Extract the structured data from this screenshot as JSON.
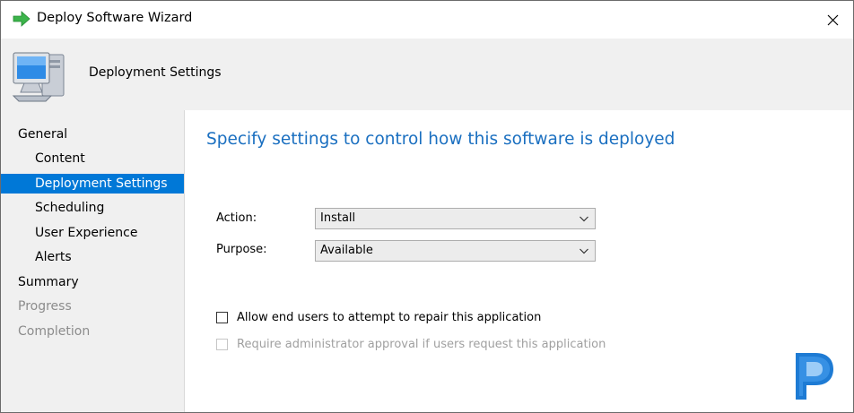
{
  "window": {
    "title": "Deploy Software Wizard"
  },
  "icons": {
    "title": "green-arrow-icon",
    "header": "computer-icon",
    "close": "close-icon",
    "chevron": "chevron-down-icon",
    "brand": "prajwal-p-logo"
  },
  "header": {
    "title": "Deployment Settings"
  },
  "nav": {
    "items": [
      {
        "label": "General",
        "level": 0,
        "state": "normal"
      },
      {
        "label": "Content",
        "level": 1,
        "state": "normal"
      },
      {
        "label": "Deployment Settings",
        "level": 1,
        "state": "selected"
      },
      {
        "label": "Scheduling",
        "level": 1,
        "state": "normal"
      },
      {
        "label": "User Experience",
        "level": 1,
        "state": "normal"
      },
      {
        "label": "Alerts",
        "level": 1,
        "state": "normal"
      },
      {
        "label": "Summary",
        "level": 0,
        "state": "normal"
      },
      {
        "label": "Progress",
        "level": 0,
        "state": "disabled"
      },
      {
        "label": "Completion",
        "level": 0,
        "state": "disabled"
      }
    ]
  },
  "main": {
    "heading": "Specify settings to control how this software is deployed",
    "action": {
      "label": "Action:",
      "value": "Install"
    },
    "purpose": {
      "label": "Purpose:",
      "value": "Available"
    },
    "repair": {
      "label": "Allow end users to attempt to repair this application",
      "checked": false,
      "enabled": true
    },
    "approval": {
      "label": "Require administrator approval if users request this application",
      "checked": false,
      "enabled": false
    }
  },
  "colors": {
    "accent": "#0078d7",
    "heading": "#1a6fc0",
    "panel": "#f0f0f0",
    "disabled_text": "#8c8c8c"
  }
}
